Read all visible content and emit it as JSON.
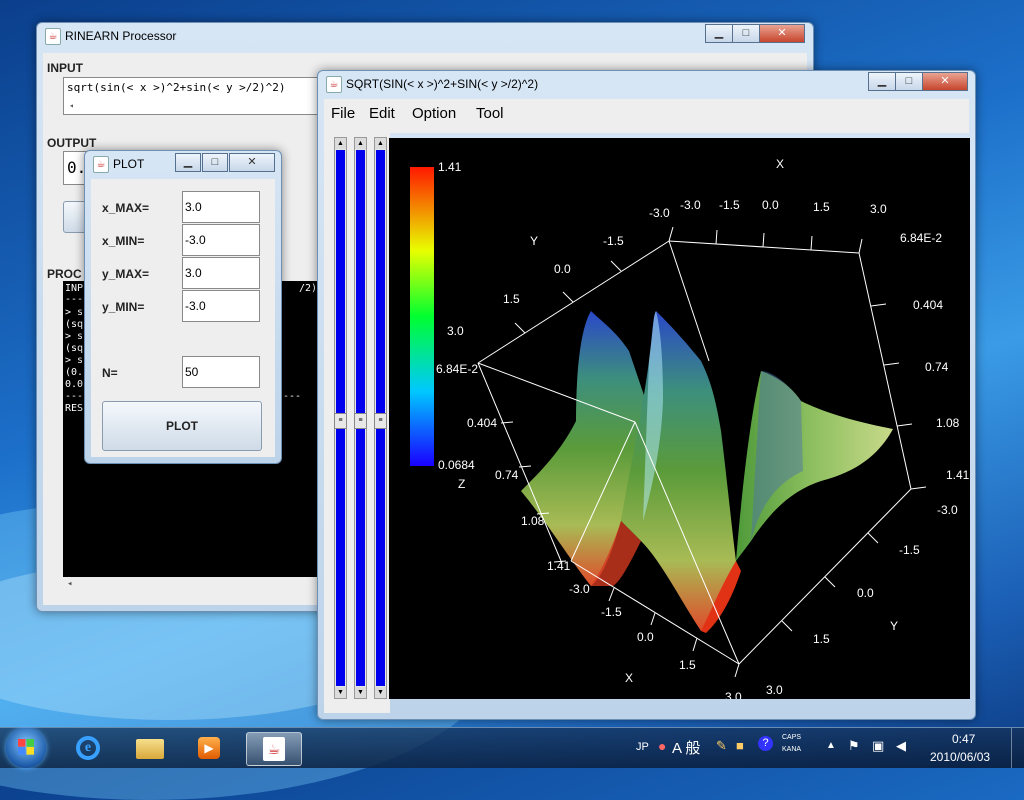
{
  "main_window": {
    "title": "RINEARN Processor",
    "input_label": "INPUT",
    "input_value": "sqrt(sin(< x >)^2+sin(< y >/2)^2)",
    "output_label": "OUTPUT",
    "output_value": "0.",
    "process_label": "PROC",
    "console_lines": [
      "INP",
      "---",
      "> s",
      "(sq",
      "> s",
      "(sq",
      "> s",
      "(0.",
      "0.0",
      "---",
      "RES"
    ],
    "console_tail": [
      "/2)^2)",
      "",
      "",
      "",
      "",
      "",
      "",
      "",
      "",
      "---",
      ""
    ]
  },
  "plot_dialog": {
    "title": "PLOT",
    "x_max_label": "x_MAX=",
    "x_max_value": "3.0",
    "x_min_label": "x_MIN=",
    "x_min_value": "-3.0",
    "y_max_label": "y_MAX=",
    "y_max_value": "3.0",
    "y_min_label": "y_MIN=",
    "y_min_value": "-3.0",
    "n_label": "N=",
    "n_value": "50",
    "plot_button": "PLOT"
  },
  "graph_window": {
    "title": "SQRT(SIN(< x >)^2+SIN(< y >/2)^2)",
    "menu": [
      "File",
      "Edit",
      "Option",
      "Tool"
    ],
    "colorbar_max": "1.41",
    "colorbar_min": "0.0684",
    "colorbar_z": "Z",
    "top_x_label": "X",
    "top_x_ticks": [
      "-3.0",
      "-1.5",
      "0.0",
      "1.5",
      "3.0"
    ],
    "top_y_label": "Y",
    "top_y_ticks": [
      "-1.5",
      "0.0",
      "1.5",
      "3.0"
    ],
    "right_z_ticks": [
      "6.84E-2",
      "0.404",
      "0.74",
      "1.08",
      "1.41"
    ],
    "left_z_ticks": [
      "6.84E-2",
      "0.404",
      "0.74",
      "1.08",
      "1.41"
    ],
    "bottom_x_label": "X",
    "bottom_x_ticks": [
      "-3.0",
      "-1.5",
      "0.0",
      "1.5",
      "3.0"
    ],
    "bottom_y_label": "Y",
    "bottom_y_ticks": [
      "-3.0",
      "-1.5",
      "0.0",
      "1.5",
      "3.0"
    ]
  },
  "taskbar": {
    "lang": "JP",
    "ime": "A 般",
    "caps": "CAPS",
    "kana": "KANA",
    "time": "0:47",
    "date": "2010/06/03"
  }
}
